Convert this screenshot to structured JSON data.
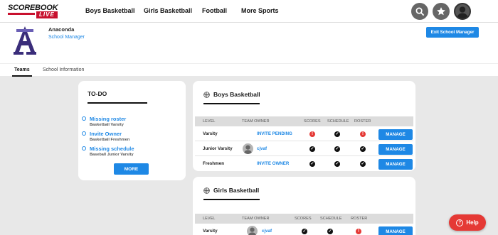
{
  "brand": {
    "logo_top": "SCOREBOOK",
    "logo_bottom": "LIVE"
  },
  "nav": {
    "links": [
      "Boys Basketball",
      "Girls Basketball",
      "Football",
      "More Sports"
    ],
    "icons": [
      "search-icon",
      "star-icon",
      "user-avatar"
    ]
  },
  "school": {
    "name": "Anaconda",
    "role": "School Manager",
    "exit_label": "Exit School Manager"
  },
  "tabs": [
    "Teams",
    "School Information"
  ],
  "todo": {
    "title": "TO-DO",
    "items": [
      {
        "link": "Missing roster",
        "sub": "Basketball Varsity"
      },
      {
        "link": "Invite Owner",
        "sub": "Basketball Freshmen"
      },
      {
        "link": "Missing schedule",
        "sub": "Baseball Junior Varsity"
      }
    ],
    "more_label": "MORE"
  },
  "columns": [
    "LEVEL",
    "TEAM OWNER",
    "SCORES",
    "SCHEDULE",
    "ROSTER"
  ],
  "teams": [
    {
      "title": "Boys Basketball",
      "rows": [
        {
          "level": "Varsity",
          "owner": "INVITE PENDING",
          "scores": "alert",
          "schedule": "ok",
          "roster": "alert",
          "action": "MANAGE"
        },
        {
          "level": "Junior Varsity",
          "owner": "cjvaf",
          "scores": "ok",
          "schedule": "ok",
          "roster": "ok",
          "action": "MANAGE"
        },
        {
          "level": "Freshmen",
          "owner": "INVITE OWNER",
          "scores": "ok",
          "schedule": "ok",
          "roster": "ok",
          "action": "MANAGE"
        }
      ]
    },
    {
      "title": "Girls Basketball",
      "rows": [
        {
          "level": "Varsity",
          "owner": "cjvaf",
          "scores": "ok",
          "schedule": "ok",
          "roster": "alert",
          "action": "MANAGE"
        }
      ]
    }
  ],
  "help_label": "Help",
  "colors": {
    "accent": "#1e88e5",
    "alert": "#e53935",
    "brand_red": "#c8102e"
  }
}
